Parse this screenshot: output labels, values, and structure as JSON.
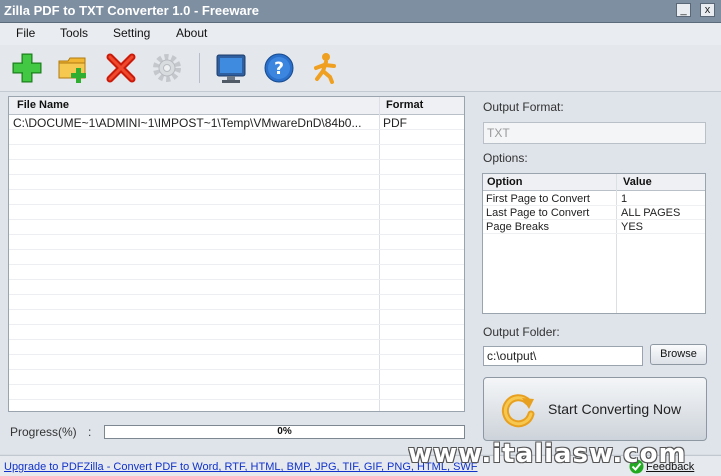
{
  "window": {
    "title": "Zilla PDF to TXT Converter 1.0 - Freeware",
    "minimize": "_",
    "close": "x"
  },
  "menu": [
    "File",
    "Tools",
    "Setting",
    "About"
  ],
  "toolbar": {
    "icons": [
      "add-file-icon",
      "add-folder-icon",
      "remove-icon",
      "settings-gear-icon",
      "monitor-icon",
      "help-icon",
      "runner-icon"
    ]
  },
  "filelist": {
    "columns": [
      "File Name",
      "Format"
    ],
    "rows": [
      {
        "name": "C:\\DOCUME~1\\ADMINI~1\\IMPOST~1\\Temp\\VMwareDnD\\84b0...",
        "format": "PDF"
      }
    ]
  },
  "output_format": {
    "label": "Output Format:",
    "value": "TXT"
  },
  "options": {
    "label": "Options:",
    "columns": [
      "Option",
      "Value"
    ],
    "rows": [
      {
        "option": "First Page to Convert",
        "value": "1"
      },
      {
        "option": "Last Page to Convert",
        "value": "ALL PAGES"
      },
      {
        "option": "Page Breaks",
        "value": "YES"
      }
    ]
  },
  "output_folder": {
    "label": "Output Folder:",
    "value": "c:\\output\\",
    "browse": "Browse"
  },
  "start_button": {
    "label": "Start Converting Now"
  },
  "progress": {
    "label": "Progress(%)",
    "colon": ":",
    "value": 0,
    "text": "0%"
  },
  "status": {
    "upgrade_link": "Upgrade to PDFZilla - Convert PDF to Word, RTF, HTML, BMP, JPG, TIF, GIF, PNG, HTML, SWF",
    "feedback": "Feedback"
  },
  "watermark": "www.italiasw.com",
  "colors": {
    "titlebar": "#7e8fa2",
    "link": "#1133cc",
    "accent_green": "#22aa22",
    "accent_red": "#dd2211"
  }
}
